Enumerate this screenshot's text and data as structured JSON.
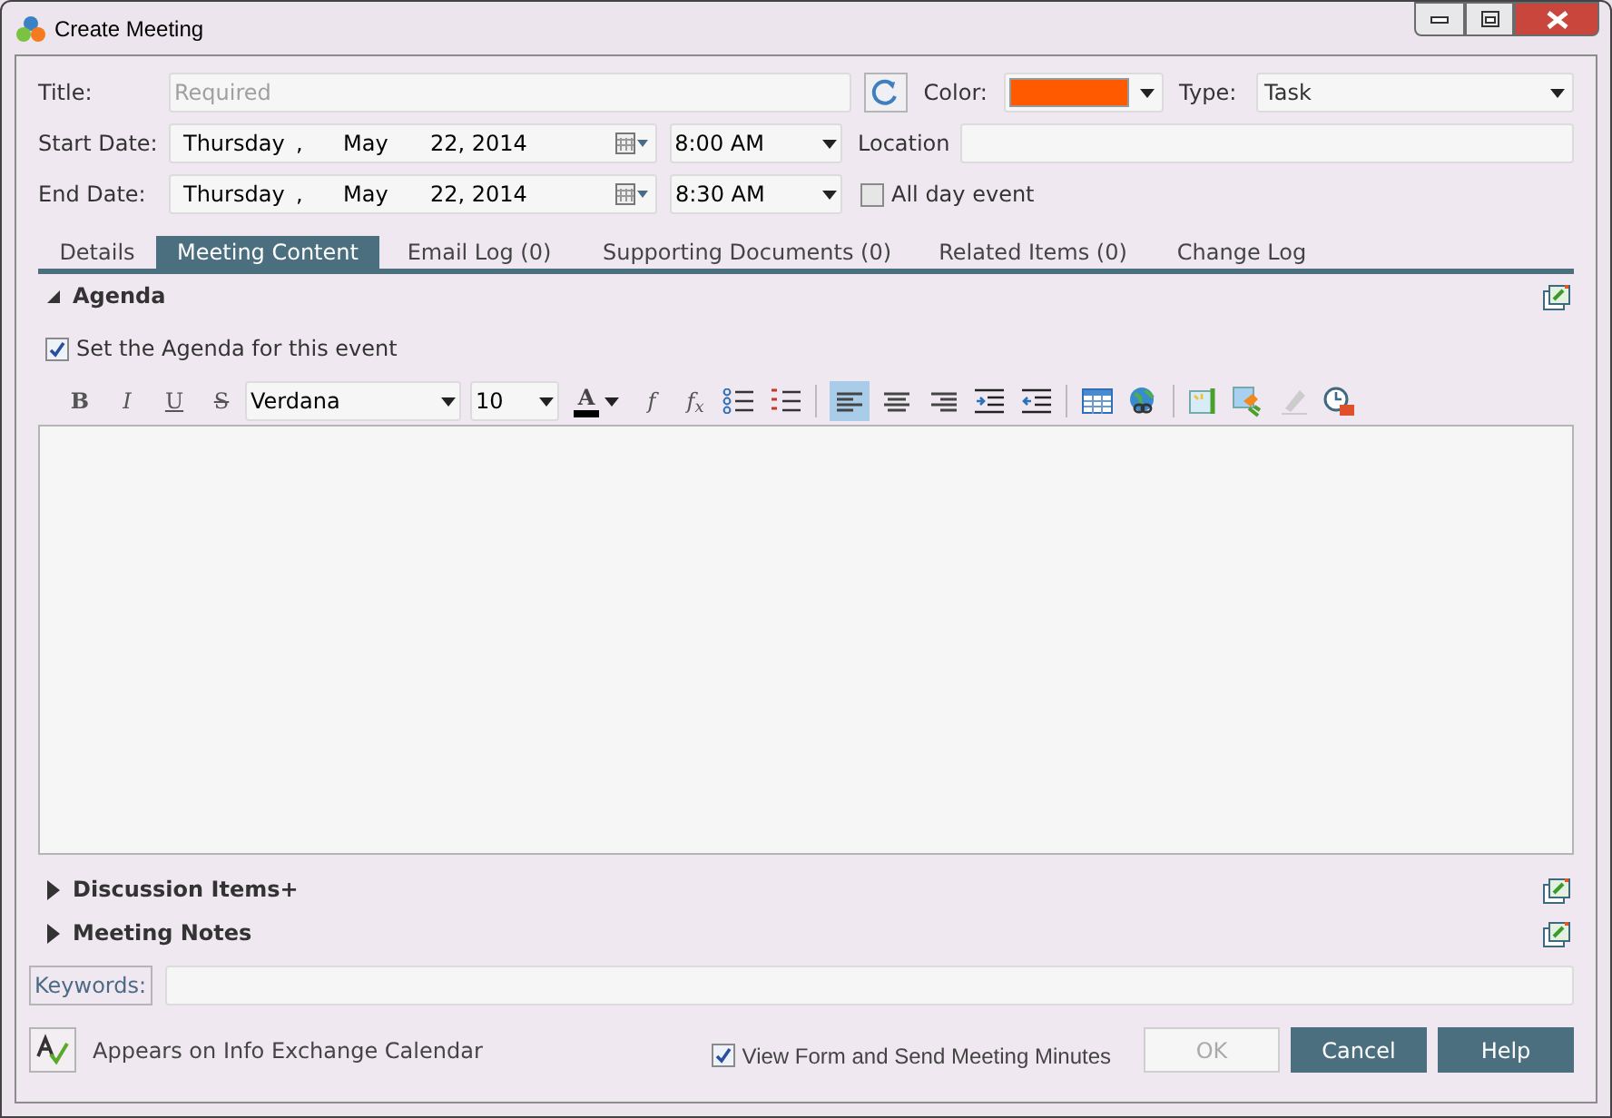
{
  "window": {
    "title": "Create Meeting"
  },
  "form": {
    "title": {
      "label": "Title:",
      "placeholder": "Required"
    },
    "color": {
      "label": "Color:",
      "color": "#ff5a00"
    },
    "type": {
      "label": "Type:",
      "value": "Task"
    },
    "start": {
      "label": "Start Date:",
      "weekday": "Thursday",
      "comma": ",",
      "month": "May",
      "day": "22, 2014",
      "time": "8:00 AM"
    },
    "location": {
      "label": "Location"
    },
    "end": {
      "label": "End Date:",
      "weekday": "Thursday",
      "comma": ",",
      "month": "May",
      "day": "22, 2014",
      "time": "8:30 AM"
    },
    "all_day": {
      "label": "All day event",
      "checked": false
    }
  },
  "tabs": [
    {
      "label": "Details",
      "selected": false
    },
    {
      "label": "Meeting Content",
      "selected": true
    },
    {
      "label": "Email Log (0)",
      "selected": false
    },
    {
      "label": "Supporting Documents (0)",
      "selected": false
    },
    {
      "label": "Related Items (0)",
      "selected": false
    },
    {
      "label": "Change Log",
      "selected": false
    }
  ],
  "sections": [
    {
      "title": "Agenda",
      "expanded": true
    },
    {
      "title": "Discussion Items+",
      "expanded": false
    },
    {
      "title": "Meeting Notes",
      "expanded": false
    }
  ],
  "agenda": {
    "set_agenda": {
      "label": "Set the Agenda for this event",
      "checked": true
    },
    "format_buttons": [
      "B",
      "I",
      "U",
      "S"
    ],
    "font": "Verdana",
    "size": "10",
    "font_color": {
      "letter": "A",
      "color": "#000000"
    },
    "function_buttons": [
      "f",
      "f$_{x}$"
    ],
    "alignment": [
      {
        "selected": true
      },
      {
        "selected": false
      },
      {
        "selected": false
      }
    ]
  },
  "keywords": {
    "label": "Keywords:"
  },
  "calendar_note": "Appears on Info Exchange Calendar",
  "send_minutes": {
    "label": "View Form and Send Meeting Minutes",
    "checked": true
  },
  "buttons": [
    {
      "label": "OK",
      "disabled": true
    },
    {
      "label": "Cancel",
      "disabled": false
    },
    {
      "label": "Help",
      "disabled": false
    }
  ]
}
